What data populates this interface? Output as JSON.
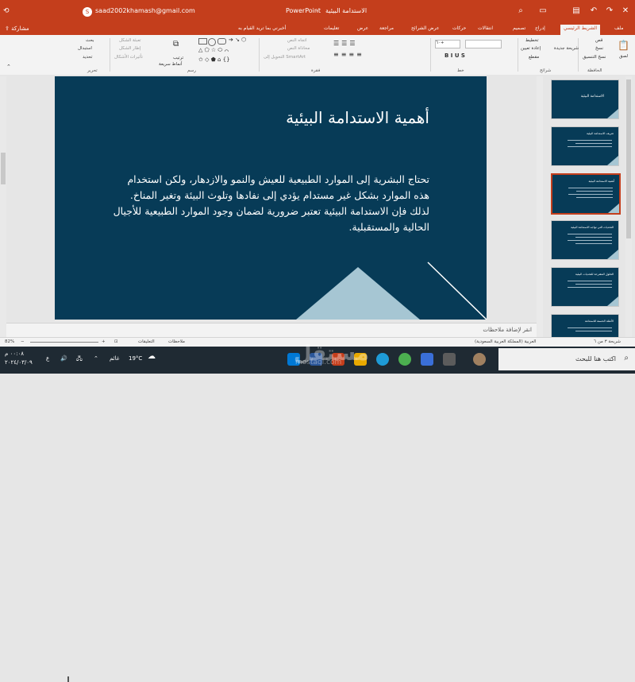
{
  "titlebar": {
    "doc_title": "الاستدامة البيئية",
    "separator": "-",
    "app_name": "PowerPoint",
    "account_email": "saad2002khamash@gmail.com",
    "avatar_letter": "S",
    "colors": {
      "accent": "#c43e1c"
    }
  },
  "tabs": {
    "items": [
      "ملف",
      "الشريط الرئيسي",
      "إدراج",
      "تصميم",
      "انتقالات",
      "حركات",
      "عرض الشرائح",
      "مراجعة",
      "عرض",
      "تعليمات"
    ],
    "tell_me": "أخبرني بما تريد القيام به",
    "share": "مشاركة"
  },
  "ribbon": {
    "clipboard": {
      "paste": "لصق",
      "cut": "قص",
      "copy": "نسخ",
      "format_painter": "نسخ التنسيق",
      "group": "الحافظة"
    },
    "slides": {
      "new_slide": "شريحة جديدة",
      "layout": "تخطيط",
      "reset": "إعادة تعيين",
      "section": "مقطع",
      "group": "شرائح"
    },
    "font": {
      "size": "٦٠+",
      "group": "خط"
    },
    "paragraph": {
      "text_direction": "اتجاه النص",
      "align_text": "محاذاة النص",
      "smartart": "التحويل إلى SmartArt",
      "group": "فقرة"
    },
    "drawing": {
      "arrange": "ترتيب",
      "quick_styles": "أنماط سريعة",
      "fill": "تعبئة الشكل",
      "outline": "إطار الشكل",
      "effects": "تأثيرات الأشكال",
      "group": "رسم"
    },
    "editing": {
      "find": "بحث",
      "replace": "استبدال",
      "select": "تحديد",
      "group": "تحرير"
    }
  },
  "thumbnails": [
    {
      "number": "1",
      "star": "★",
      "title": "الاستدامة البيئية",
      "lines": 0,
      "selected": false
    },
    {
      "number": "2",
      "star": "★",
      "title": "تعريف الاستدامة البيئية",
      "lines": 3,
      "selected": false
    },
    {
      "number": "3",
      "star": "★",
      "title": "أهمية الاستدامة البيئية",
      "lines": 4,
      "selected": true
    },
    {
      "number": "4",
      "star": "★",
      "title": "التحديات التي تواجه الاستدامة البيئية",
      "lines": 4,
      "selected": false
    },
    {
      "number": "5",
      "star": "★",
      "title": "الحلول المقترحة للتحديات البيئية",
      "lines": 3,
      "selected": false
    },
    {
      "number": "6",
      "star": "★",
      "title": "الأمثلة الحسنة للاستدامة",
      "lines": 2,
      "selected": false
    }
  ],
  "slide": {
    "title": "أهمية الاستدامة البيئية",
    "body": "تحتاج البشرية إلى الموارد الطبيعية للعيش والنمو والازدهار، ولكن استخدام هذه الموارد بشكل غير مستدام يؤدي إلى نفادها وتلوث البيئة وتغير المناخ. لذلك فإن الاستدامة البيئية تعتبر ضرورية لضمان وجود الموارد الطبيعية للأجيال الحالية والمستقبلية.",
    "colors": {
      "background": "#073b57",
      "triangle": "#a6c6d3",
      "line": "#ffffff"
    }
  },
  "notes": {
    "placeholder": "انقر لإضافة ملاحظات"
  },
  "status": {
    "slide_counter": "شريحة ٣ من ٦",
    "language": "العربية (المملكة العربية السعودية)",
    "notes": "ملاحظات",
    "comments": "التعليقات",
    "zoom": "82%",
    "zoom_fraction": 0.55
  },
  "taskbar": {
    "search_placeholder": "اكتب هنا للبحث",
    "weather": "19°C",
    "weather_label": "غائم",
    "time": "٠٠:٠٨ م",
    "date": "٢٠٢٤/٠٣/٠٩",
    "watermark": "مستقل",
    "watermark_sub": "mostaql.com"
  }
}
